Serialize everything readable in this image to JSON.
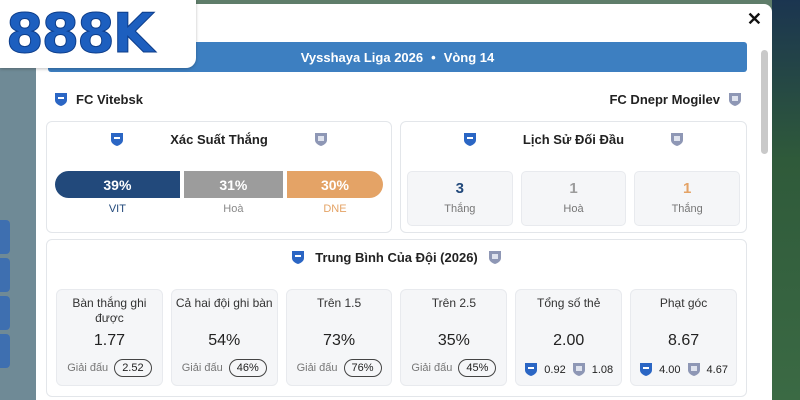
{
  "brand": {
    "logo_text": "888K"
  },
  "modal": {
    "title": {
      "league": "Vysshaya Liga 2026",
      "separator": "•",
      "round": "Vòng 14"
    },
    "close_label": "✕",
    "home_team": "FC Vitebsk",
    "away_team": "FC Dnepr Mogilev"
  },
  "win_probability": {
    "title": "Xác Suất Thắng",
    "home": {
      "value": "39%",
      "label": "VIT",
      "share": 39
    },
    "draw": {
      "value": "31%",
      "label": "Hoà",
      "share": 31
    },
    "away": {
      "value": "30%",
      "label": "DNE",
      "share": 30
    }
  },
  "head_to_head": {
    "title": "Lịch Sử Đối Đầu",
    "boxes": [
      {
        "value": "3",
        "label": "Thắng"
      },
      {
        "value": "1",
        "label": "Hoà"
      },
      {
        "value": "1",
        "label": "Thắng"
      }
    ]
  },
  "team_average": {
    "title": "Trung Bình Của Đội (2026)",
    "stats": [
      {
        "label": "Bàn thắng ghi được",
        "value": "1.77",
        "league_label": "Giải đấu",
        "league_value": "2.52"
      },
      {
        "label": "Cả hai đội ghi bàn",
        "value": "54%",
        "league_label": "Giải đấu",
        "league_value": "46%"
      },
      {
        "label": "Trên 1.5",
        "value": "73%",
        "league_label": "Giải đấu",
        "league_value": "76%"
      },
      {
        "label": "Trên 2.5",
        "value": "35%",
        "league_label": "Giải đấu",
        "league_value": "45%"
      },
      {
        "label": "Tổng số thẻ",
        "value": "2.00",
        "home_value": "0.92",
        "away_value": "1.08"
      },
      {
        "label": "Phạt góc",
        "value": "8.67",
        "home_value": "4.00",
        "away_value": "4.67"
      }
    ]
  },
  "colors": {
    "accent": "#3d7fc1",
    "home": "#22497b",
    "draw": "#9c9c9c",
    "away": "#e4a366",
    "home_shield": "#2b66c4",
    "away_shield": "#8e97b5"
  }
}
